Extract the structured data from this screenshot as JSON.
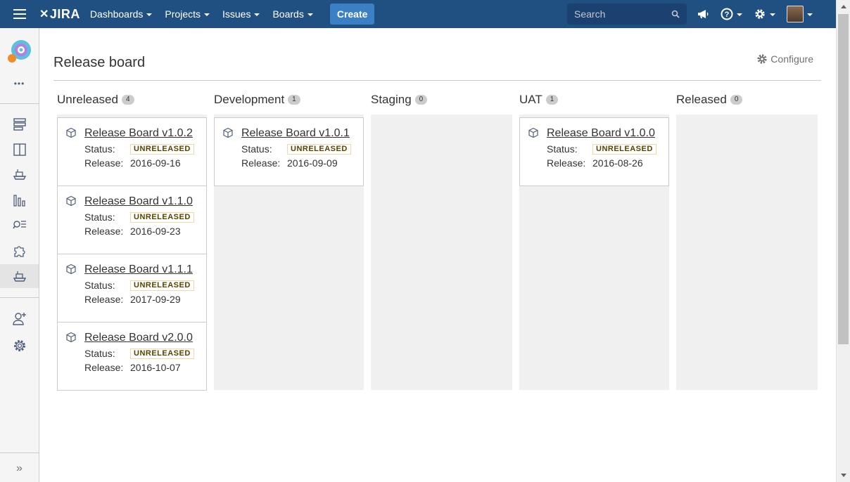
{
  "nav": {
    "logo": "JIRA",
    "items": [
      "Dashboards",
      "Projects",
      "Issues",
      "Boards"
    ],
    "create_label": "Create",
    "search_placeholder": "Search"
  },
  "sidebar": {
    "icons": [
      "backlog-icon",
      "board-icon",
      "releases-icon",
      "reports-icon",
      "issues-search-icon",
      "add-ons-icon",
      "release-board-icon",
      "add-people-icon",
      "settings-icon"
    ],
    "more_label": "•••",
    "collapse_label": "»"
  },
  "page": {
    "title": "Release board",
    "configure_label": "Configure"
  },
  "columns": [
    {
      "name": "Unreleased",
      "count": "4",
      "cards": [
        {
          "title": "Release Board v1.0.2",
          "status_label": "Status:",
          "status": "UNRELEASED",
          "release_label": "Release:",
          "release": "2016-09-16"
        },
        {
          "title": "Release Board v1.1.0",
          "status_label": "Status:",
          "status": "UNRELEASED",
          "release_label": "Release:",
          "release": "2016-09-23"
        },
        {
          "title": "Release Board v1.1.1",
          "status_label": "Status:",
          "status": "UNRELEASED",
          "release_label": "Release:",
          "release": "2017-09-29"
        },
        {
          "title": "Release Board v2.0.0",
          "status_label": "Status:",
          "status": "UNRELEASED",
          "release_label": "Release:",
          "release": "2016-10-07"
        }
      ]
    },
    {
      "name": "Development",
      "count": "1",
      "cards": [
        {
          "title": "Release Board v1.0.1",
          "status_label": "Status:",
          "status": "UNRELEASED",
          "release_label": "Release:",
          "release": "2016-09-09"
        }
      ]
    },
    {
      "name": "Staging",
      "count": "0",
      "cards": []
    },
    {
      "name": "UAT",
      "count": "1",
      "cards": [
        {
          "title": "Release Board v1.0.0",
          "status_label": "Status:",
          "status": "UNRELEASED",
          "release_label": "Release:",
          "release": "2016-08-26"
        }
      ]
    },
    {
      "name": "Released",
      "count": "0",
      "cards": []
    }
  ],
  "colors": {
    "nav_bg": "#205081",
    "create_bg": "#3b7fc4",
    "column_bg": "#f0f0f0",
    "badge_border": "#f0d9a8"
  }
}
